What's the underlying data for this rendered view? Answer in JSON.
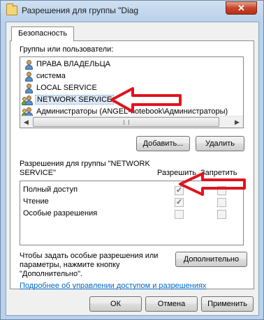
{
  "window": {
    "title": "Разрешения для группы \"Diag",
    "close_glyph": "✕"
  },
  "tab": {
    "label": "Безопасность"
  },
  "users": {
    "label": "Группы или пользователи:",
    "items": [
      {
        "name": "ПРАВА ВЛАДЕЛЬЦА",
        "icon": "user-icon"
      },
      {
        "name": "система",
        "icon": "user-icon"
      },
      {
        "name": "LOCAL SERVICE",
        "icon": "user-icon"
      },
      {
        "name": "NETWORK SERVICE",
        "icon": "group-icon",
        "selected": true
      },
      {
        "name": "Администраторы (ANGEL-notebook\\Администраторы)",
        "icon": "group-icon"
      }
    ]
  },
  "buttons": {
    "add": "Добавить...",
    "remove": "Удалить",
    "advanced": "Дополнительно",
    "ok": "ОК",
    "cancel": "Отмена",
    "apply": "Применить"
  },
  "permissions": {
    "label_line1": "Разрешения для группы \"NETWORK",
    "label_line2": "SERVICE\"",
    "allow_header": "Разрешить",
    "deny_header": "Запретить",
    "rows": [
      {
        "name": "Полный доступ",
        "allow": true,
        "deny": false
      },
      {
        "name": "Чтение",
        "allow": true,
        "deny": false
      },
      {
        "name": "Особые разрешения",
        "allow": false,
        "deny": false
      }
    ]
  },
  "advanced_hint": {
    "line1": "Чтобы задать особые разрешения или",
    "line2": "параметры, нажмите кнопку",
    "line3": "\"Дополнительно\"."
  },
  "help_link": "Подробнее об управлении доступом и разрешениях",
  "annotation_color": "#e0141e"
}
